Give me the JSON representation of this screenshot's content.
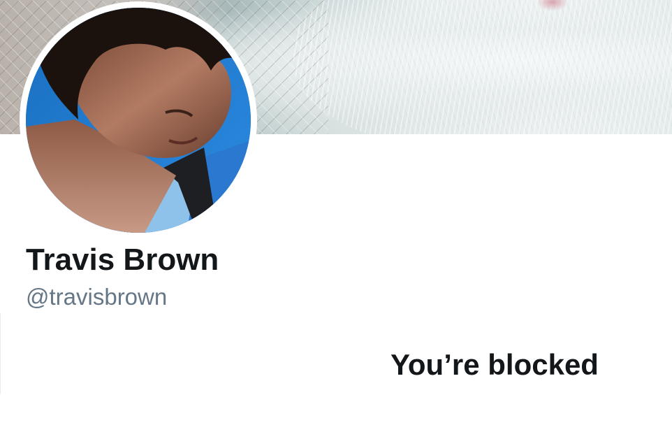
{
  "profile": {
    "display_name": "Travis Brown",
    "handle": "@travisbrown"
  },
  "status": {
    "message": "You’re blocked"
  },
  "colors": {
    "text_primary": "#14171a",
    "text_secondary": "#657786",
    "background": "#ffffff"
  }
}
